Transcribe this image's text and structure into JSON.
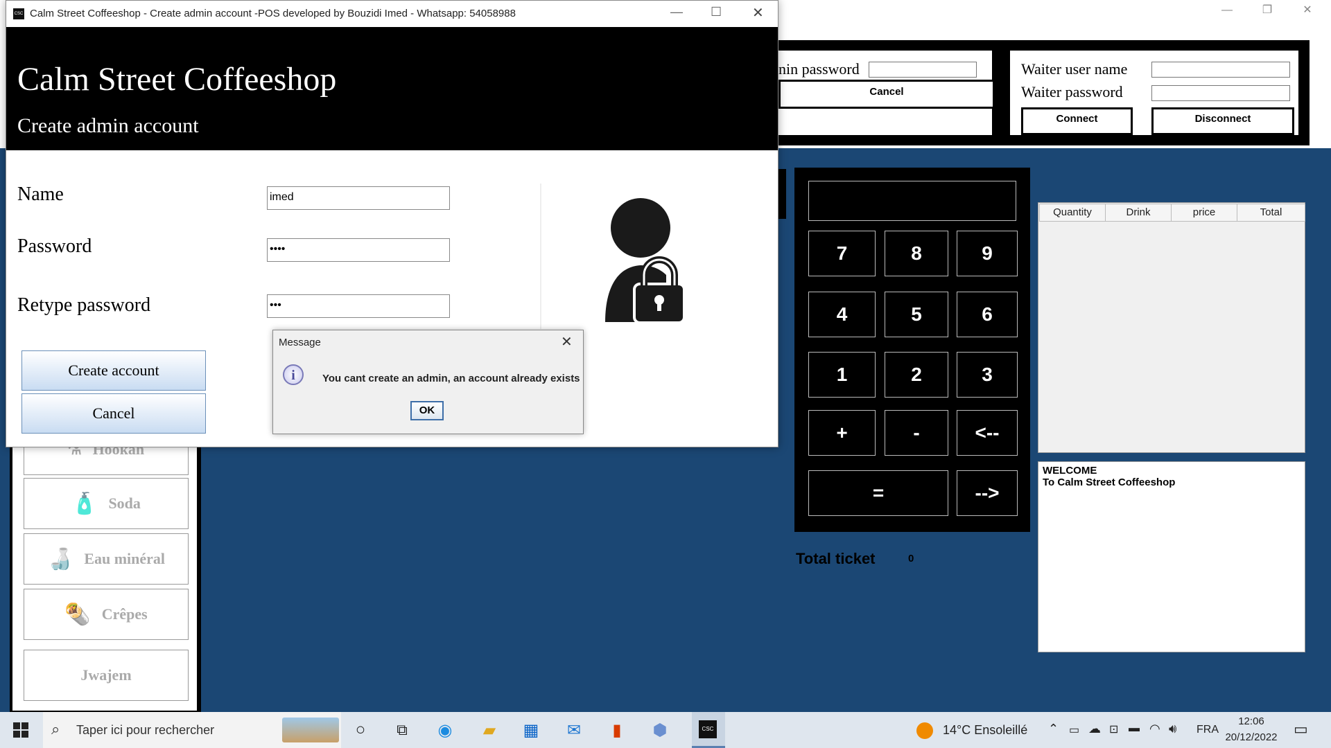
{
  "dialog": {
    "title": "Calm Street Coffeeshop - Create admin account -POS developed by Bouzidi Imed - Whatsapp: 54058988",
    "header_title": "Calm Street Coffeeshop",
    "header_subtitle": "Create admin account",
    "fields": {
      "name_label": "Name",
      "name_value": "imed",
      "password_label": "Password",
      "password_value": "••••",
      "retype_label": "Retype password",
      "retype_value": "•••"
    },
    "create_button": "Create account",
    "cancel_button": "Cancel"
  },
  "message_box": {
    "title": "Message",
    "text": "You cant create an admin, an account already exists",
    "ok_button": "OK"
  },
  "background": {
    "admin_password_label": "nin password",
    "cancel_button": "Cancel",
    "waiter_user_label": "Waiter user name",
    "waiter_password_label": "Waiter password",
    "connect_button": "Connect",
    "disconnect_button": "Disconnect",
    "categories": [
      "Hookah",
      "Soda",
      "Eau minéral",
      "Crêpes",
      "Jwajem"
    ],
    "keypad": [
      "7",
      "8",
      "9",
      "4",
      "5",
      "6",
      "1",
      "2",
      "3",
      "+",
      "-",
      "<--",
      "=",
      "-->"
    ],
    "total_ticket_label": "Total ticket",
    "total_ticket_value": "0",
    "table_headers": [
      "Quantity",
      "Drink",
      "price",
      "Total"
    ],
    "welcome_line1": "WELCOME",
    "welcome_line2": "To Calm Street Coffeeshop"
  },
  "taskbar": {
    "search_placeholder": "Taper ici pour rechercher",
    "weather": "14°C  Ensoleillé",
    "language": "FRA",
    "time": "12:06",
    "date": "20/12/2022"
  },
  "colors": {
    "header_bg": "#000000",
    "main_bg": "#1b4774",
    "taskbar_bg": "#dfe6ee",
    "button_gradient_end": "#c9dcf2"
  }
}
